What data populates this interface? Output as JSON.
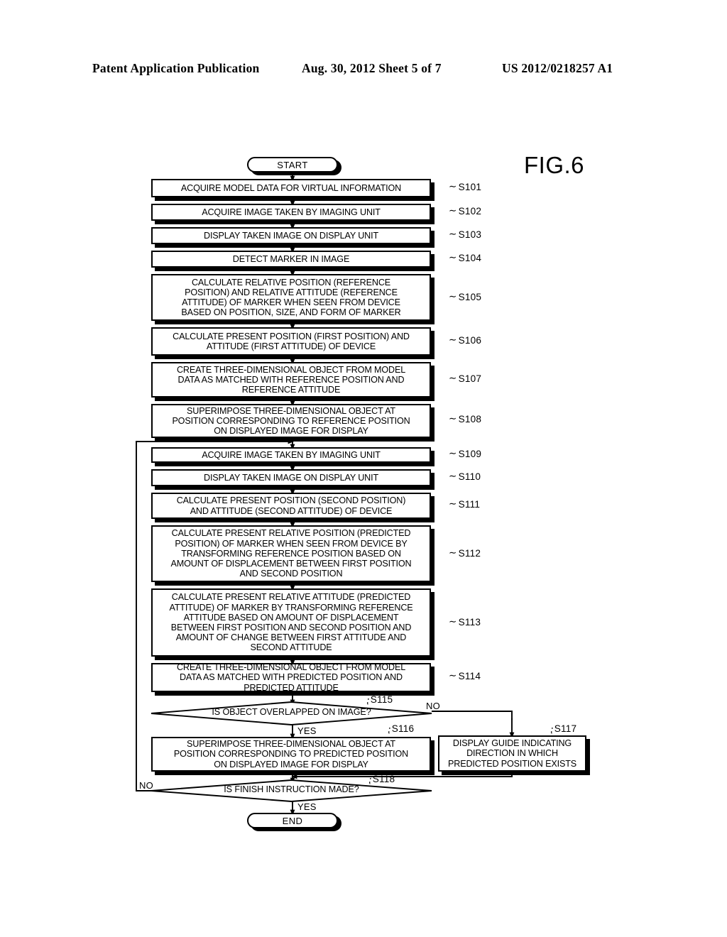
{
  "header": {
    "publication": "Patent Application Publication",
    "date_sheet": "Aug. 30, 2012  Sheet 5 of 7",
    "patent_number": "US 2012/0218257 A1"
  },
  "figure": {
    "label": "FIG.6"
  },
  "flowchart": {
    "start_label": "START",
    "end_label": "END",
    "yes_label": "YES",
    "no_label": "NO",
    "steps": [
      {
        "ref": "S101",
        "text": "ACQUIRE MODEL DATA FOR VIRTUAL INFORMATION"
      },
      {
        "ref": "S102",
        "text": "ACQUIRE IMAGE TAKEN BY IMAGING UNIT"
      },
      {
        "ref": "S103",
        "text": "DISPLAY TAKEN IMAGE ON DISPLAY UNIT"
      },
      {
        "ref": "S104",
        "text": "DETECT MARKER IN IMAGE"
      },
      {
        "ref": "S105",
        "text": "CALCULATE RELATIVE POSITION (REFERENCE\nPOSITION) AND RELATIVE ATTITUDE (REFERENCE\nATTITUDE) OF MARKER WHEN SEEN FROM DEVICE\nBASED ON POSITION, SIZE, AND FORM OF MARKER"
      },
      {
        "ref": "S106",
        "text": "CALCULATE PRESENT POSITION (FIRST POSITION) AND\nATTITUDE (FIRST ATTITUDE) OF DEVICE"
      },
      {
        "ref": "S107",
        "text": "CREATE THREE-DIMENSIONAL OBJECT FROM MODEL\nDATA AS MATCHED WITH REFERENCE POSITION AND\nREFERENCE ATTITUDE"
      },
      {
        "ref": "S108",
        "text": "SUPERIMPOSE THREE-DIMENSIONAL OBJECT AT\nPOSITION CORRESPONDING TO REFERENCE POSITION\nON DISPLAYED IMAGE FOR DISPLAY"
      },
      {
        "ref": "S109",
        "text": "ACQUIRE IMAGE TAKEN BY IMAGING UNIT"
      },
      {
        "ref": "S110",
        "text": "DISPLAY TAKEN IMAGE ON DISPLAY UNIT"
      },
      {
        "ref": "S111",
        "text": "CALCULATE PRESENT POSITION (SECOND POSITION)\nAND ATTITUDE (SECOND ATTITUDE) OF DEVICE"
      },
      {
        "ref": "S112",
        "text": "CALCULATE PRESENT RELATIVE POSITION (PREDICTED\nPOSITION) OF MARKER WHEN SEEN FROM DEVICE BY\nTRANSFORMING REFERENCE POSITION BASED ON\nAMOUNT OF DISPLACEMENT BETWEEN FIRST POSITION\nAND SECOND POSITION"
      },
      {
        "ref": "S113",
        "text": "CALCULATE PRESENT RELATIVE ATTITUDE (PREDICTED\nATTITUDE) OF MARKER BY TRANSFORMING REFERENCE\nATTITUDE BASED ON AMOUNT OF DISPLACEMENT\nBETWEEN FIRST POSITION AND SECOND POSITION AND\nAMOUNT OF CHANGE BETWEEN FIRST ATTITUDE AND\nSECOND ATTITUDE"
      },
      {
        "ref": "S114",
        "text": "CREATE THREE-DIMENSIONAL OBJECT FROM MODEL\nDATA AS MATCHED WITH PREDICTED POSITION AND\nPREDICTED ATTITUDE"
      },
      {
        "ref": "S115",
        "text": "IS OBJECT OVERLAPPED ON IMAGE?"
      },
      {
        "ref": "S116",
        "text": "SUPERIMPOSE THREE-DIMENSIONAL OBJECT AT\nPOSITION CORRESPONDING TO PREDICTED POSITION\nON DISPLAYED IMAGE FOR DISPLAY"
      },
      {
        "ref": "S117",
        "text": "DISPLAY GUIDE INDICATING\nDIRECTION IN WHICH\nPREDICTED POSITION EXISTS"
      },
      {
        "ref": "S118",
        "text": "IS FINISH INSTRUCTION MADE?"
      }
    ]
  }
}
